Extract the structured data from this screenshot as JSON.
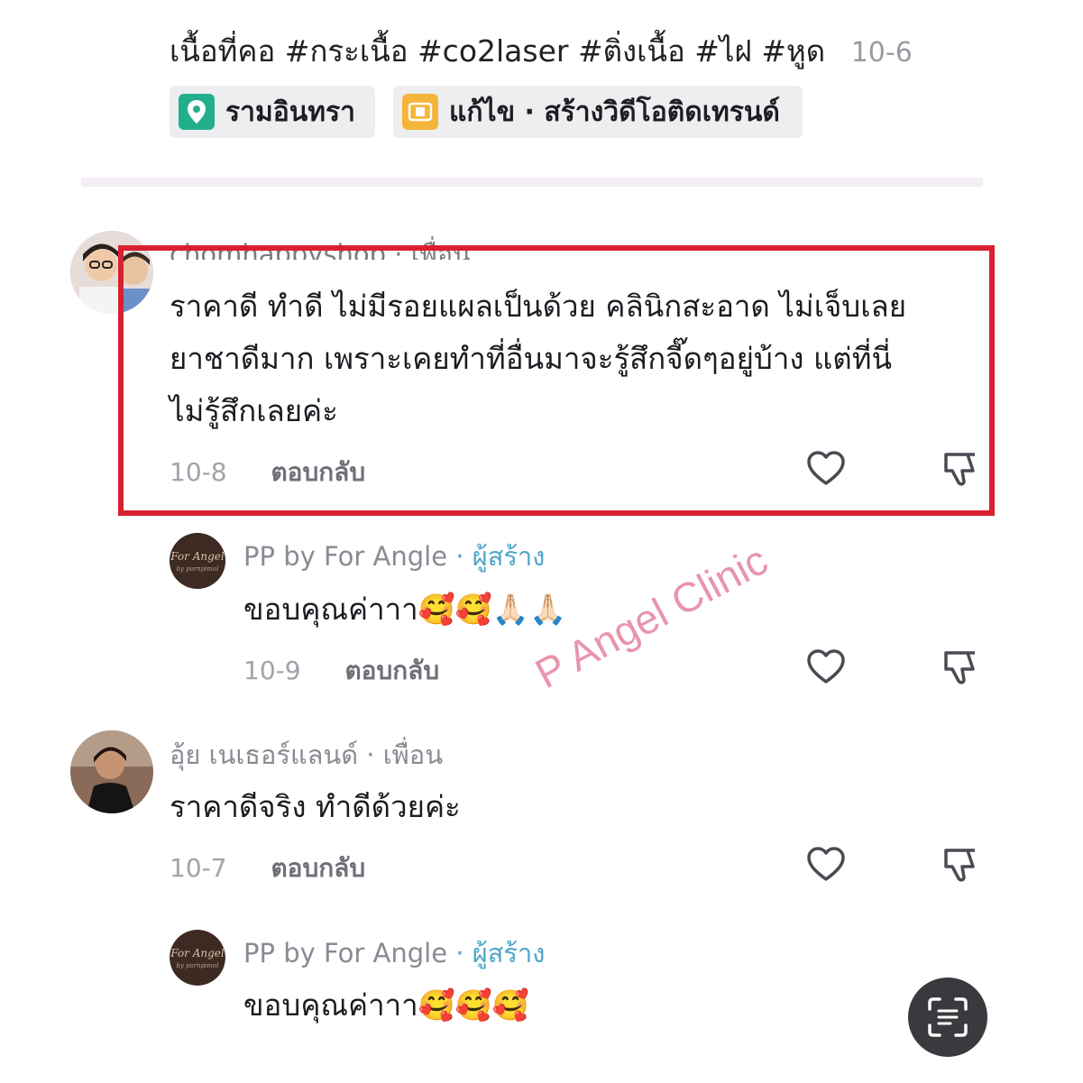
{
  "post": {
    "caption": "เนื้อที่คอ #กระเนื้อ #co2laser #ติ่งเนื้อ #ไฝ #หูด",
    "date": "10-6",
    "chips": [
      {
        "label": "รามอินทรา",
        "icon": "location-pin-icon",
        "color": "#22b08c"
      },
      {
        "label": "แก้ไข · สร้างวิดีโอติดเทรนด์",
        "icon": "film-icon",
        "color": "#f5b53a"
      }
    ]
  },
  "comments": [
    {
      "username": "chomhappyshop · เพื่อน",
      "text_lines": [
        "ราคาดี ทำดี ไม่มีรอยแผลเป็นด้วย คลินิกสะอาด ไม่เจ็บเลย",
        "ยาชาดีมาก เพราะเคยทำที่อื่นมาจะรู้สึกจี๊ดๆอยู่บ้าง แต่ที่นี่",
        "ไม่รู้สึกเลยค่ะ"
      ],
      "date": "10-8",
      "reply_label": "ตอบกลับ"
    },
    {
      "username": "PP by For Angle",
      "badge": "· ผู้สร้าง",
      "text": "ขอบคุณค่าาา🥰🥰🙏🏻🙏🏻",
      "date": "10-9",
      "reply_label": "ตอบกลับ"
    },
    {
      "username": "อุ้ย เนเธอร์แลนด์ · เพื่อน",
      "text": "ราคาดีจริง ทำดีด้วยค่ะ",
      "date": "10-7",
      "reply_label": "ตอบกลับ"
    },
    {
      "username": "PP by For Angle",
      "badge": "· ผู้สร้าง",
      "text": "ขอบคุณค่าาา🥰🥰🥰"
    }
  ],
  "watermark": "P Angel Clinic",
  "colors": {
    "highlight": "#d8202f",
    "creator_tag": "#4ea6c8",
    "watermark": "#e68aa4"
  }
}
